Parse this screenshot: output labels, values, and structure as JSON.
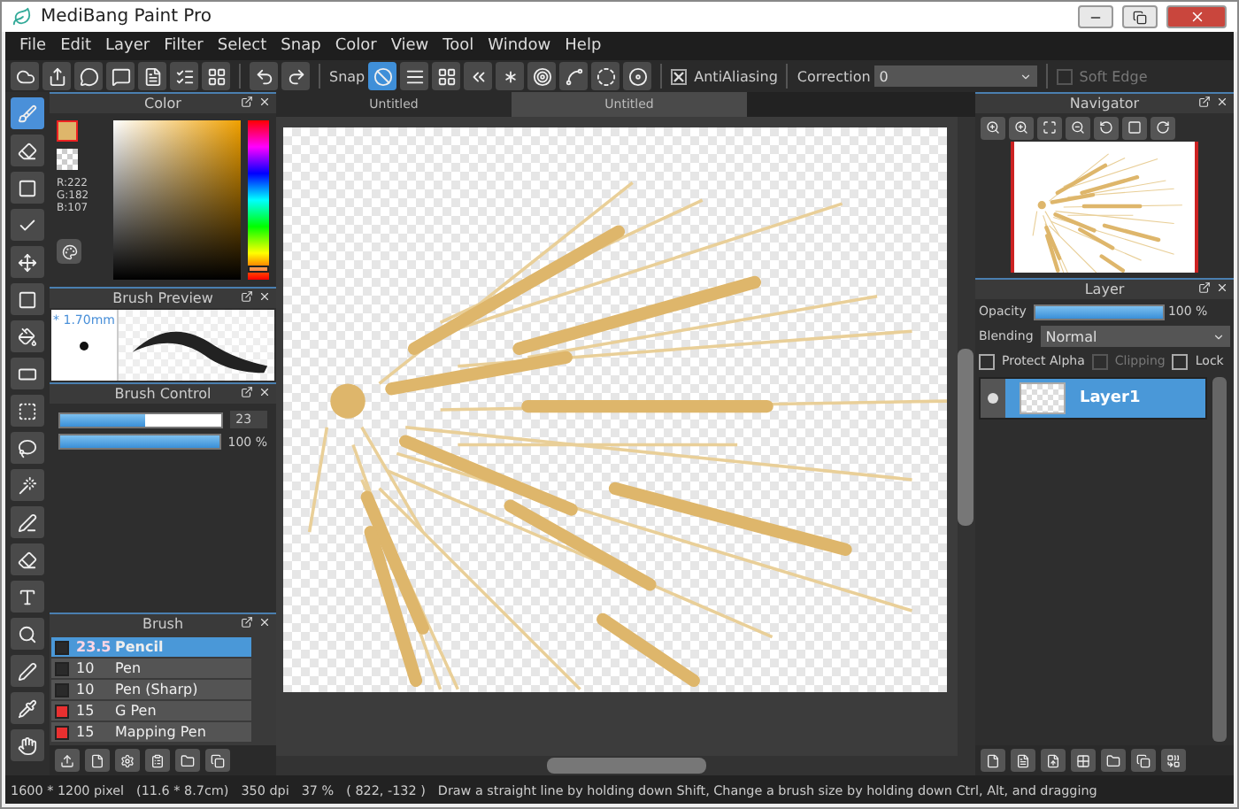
{
  "window": {
    "title": "MediBang Paint Pro"
  },
  "menu": [
    "File",
    "Edit",
    "Layer",
    "Filter",
    "Select",
    "Snap",
    "Color",
    "View",
    "Tool",
    "Window",
    "Help"
  ],
  "toolbar": {
    "file_buttons": [
      {
        "kind": "cloud"
      },
      {
        "kind": "share"
      },
      {
        "kind": "chat"
      },
      {
        "kind": "message"
      },
      {
        "kind": "page"
      },
      {
        "kind": "list"
      },
      {
        "kind": "grid"
      }
    ],
    "snap_label": "Snap",
    "snap_buttons": [
      {
        "kind": "off",
        "selected": true
      },
      {
        "kind": "parallel",
        "selected": false
      },
      {
        "kind": "grid",
        "selected": false
      },
      {
        "kind": "focus",
        "selected": false
      },
      {
        "kind": "radial",
        "selected": false
      },
      {
        "kind": "concentric",
        "selected": false
      },
      {
        "kind": "curve",
        "selected": false
      },
      {
        "kind": "circle",
        "selected": false
      },
      {
        "kind": "ring",
        "selected": false
      }
    ],
    "antialiasing": {
      "label": "AntiAliasing",
      "checked": true
    },
    "correction": {
      "label": "Correction",
      "value": "0"
    },
    "soft_edge": {
      "label": "Soft Edge",
      "checked": false,
      "disabled": true
    }
  },
  "tools": [
    {
      "kind": "brush",
      "selected": true
    },
    {
      "kind": "eraser",
      "selected": false
    },
    {
      "kind": "square",
      "selected": false
    },
    {
      "kind": "check",
      "selected": false
    },
    {
      "kind": "move",
      "selected": false
    },
    {
      "kind": "fill",
      "selected": false
    },
    {
      "kind": "bucket",
      "selected": false
    },
    {
      "kind": "gradient",
      "selected": false
    },
    {
      "kind": "select",
      "selected": false
    },
    {
      "kind": "lasso",
      "selected": false
    },
    {
      "kind": "wand",
      "selected": false
    },
    {
      "kind": "selectpen",
      "selected": false
    },
    {
      "kind": "selecteraser",
      "selected": false
    },
    {
      "kind": "text",
      "selected": false
    },
    {
      "kind": "zoomselect",
      "selected": false
    },
    {
      "kind": "pen",
      "selected": false
    },
    {
      "kind": "dropper",
      "selected": false
    },
    {
      "kind": "hand",
      "selected": false
    }
  ],
  "color_panel": {
    "title": "Color",
    "r": "R:222",
    "g": "G:182",
    "b": "B:107",
    "hue": {
      "level": 0.07
    }
  },
  "brush_preview": {
    "title": "Brush Preview",
    "size": "* 1.70mm"
  },
  "brush_control": {
    "title": "Brush Control",
    "size": {
      "level": 0.53,
      "value": "23"
    },
    "opacity": {
      "level": 1,
      "value": "100 %"
    }
  },
  "brush_panel": {
    "title": "Brush",
    "items": [
      {
        "size": "23.5",
        "name": "Pencil",
        "color": "#2a2a2a",
        "selected": true
      },
      {
        "size": "10",
        "name": "Pen",
        "color": "#2a2a2a",
        "selected": false
      },
      {
        "size": "10",
        "name": "Pen (Sharp)",
        "color": "#2a2a2a",
        "selected": false
      },
      {
        "size": "15",
        "name": "G Pen",
        "color": "#e83030",
        "selected": false
      },
      {
        "size": "15",
        "name": "Mapping Pen",
        "color": "#e83030",
        "selected": false
      }
    ]
  },
  "tabs": [
    {
      "label": "Untitled",
      "selected": false
    },
    {
      "label": "Untitled",
      "selected": true
    }
  ],
  "navigator": {
    "title": "Navigator"
  },
  "layer_panel": {
    "title": "Layer",
    "opacity": {
      "label": "Opacity",
      "level": 1,
      "value": "100 %"
    },
    "blending": {
      "label": "Blending",
      "value": "Normal"
    },
    "protect_alpha": {
      "label": "Protect Alpha",
      "checked": false
    },
    "clipping": {
      "label": "Clipping",
      "checked": false,
      "disabled": true
    },
    "lock": {
      "label": "Lock",
      "checked": false
    },
    "layers": [
      {
        "name": "Layer1",
        "visible": true,
        "selected": true
      }
    ]
  },
  "status_bar": [
    "1600 * 1200 pixel",
    "(11.6 * 8.7cm)",
    "350 dpi",
    "37 %",
    "( 822, -132 )",
    "Draw a straight line by holding down Shift, Change a brush size by holding down Ctrl, Alt, and dragging"
  ]
}
